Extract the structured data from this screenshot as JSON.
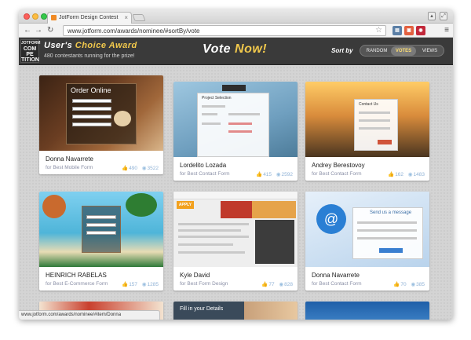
{
  "browser": {
    "tab_title": "JotForm Design Contest",
    "url": "www.jotform.com/awards/nominee/#sortBy/vote",
    "status_url": "www.jotform.com/awards/nominee/#item/Donna"
  },
  "banner": {
    "logo_lines": [
      "JOTFORM",
      "COM",
      "PE",
      "TITION"
    ],
    "title_part1": "User's",
    "title_part2": "Choice Award",
    "subtitle": "480 contestants running for the prize!",
    "vote_part1": "Vote",
    "vote_part2": "Now!",
    "sort_label": "Sort by",
    "sort_options": [
      "RANDOM",
      "VOTES",
      "VIEWS"
    ],
    "sort_active": "VOTES"
  },
  "cards": [
    {
      "name": "Donna Navarrete",
      "category": "for Best Mobile Form",
      "likes": "490",
      "views": "3522",
      "thumb_text": "Order Online"
    },
    {
      "name": "Lordelito Lozada",
      "category": "for Best Contact Form",
      "likes": "415",
      "views": "2592",
      "thumb_text": "Project Selection"
    },
    {
      "name": "Andrey Berestovoy",
      "category": "for Best Contact Form",
      "likes": "162",
      "views": "1483",
      "thumb_text": "Contact Us"
    },
    {
      "name": "HEINRICH RABELAS",
      "category": "for Best E-Commerce Form",
      "likes": "157",
      "views": "1285",
      "thumb_text": ""
    },
    {
      "name": "Kyle David",
      "category": "for Best Form Design",
      "likes": "77",
      "views": "828",
      "thumb_text": "APPLY"
    },
    {
      "name": "Donna Navarrete",
      "category": "for Best Contact Form",
      "likes": "70",
      "views": "385",
      "thumb_text": "Send us a message"
    }
  ],
  "partial_cards": [
    {
      "thumb_text": ""
    },
    {
      "thumb_text": "Fill in your Details"
    },
    {
      "thumb_text": ""
    }
  ],
  "colors": {
    "banner_bg": "#3a3a3a",
    "accent_yellow": "#f2c94c",
    "stats_blue": "#8fb2d6",
    "subtitle_gray": "#8a8fa6"
  }
}
